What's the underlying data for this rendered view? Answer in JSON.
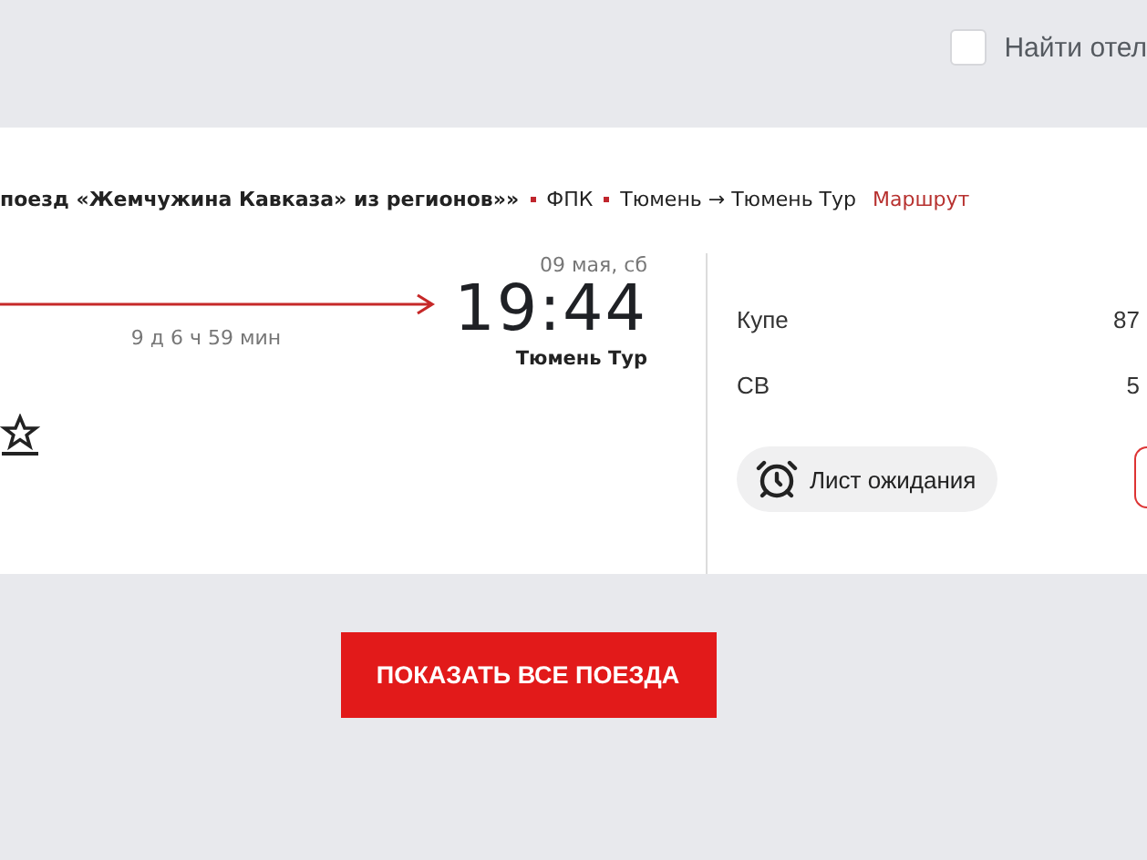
{
  "hotel_filter": {
    "label": "Найти отел",
    "checked": false
  },
  "train": {
    "title": "поезд «Жемчужина Кавказа» из регионов»»",
    "carrier": "ФПК",
    "route": "Тюмень → Тюмень Тур",
    "route_link": "Маршрут",
    "duration": "9 д 6 ч 59 мин",
    "arrival_date": "09 мая, сб",
    "arrival_time": "19:44",
    "arrival_station": "Тюмень Тур",
    "favorite": false
  },
  "classes": [
    {
      "name": "Купе",
      "seats": "87"
    },
    {
      "name": "СВ",
      "seats": "5"
    }
  ],
  "waitlist_button": "Лист ожидания",
  "show_all_button": "ПОКАЗАТЬ ВСЕ ПОЕЗДА"
}
